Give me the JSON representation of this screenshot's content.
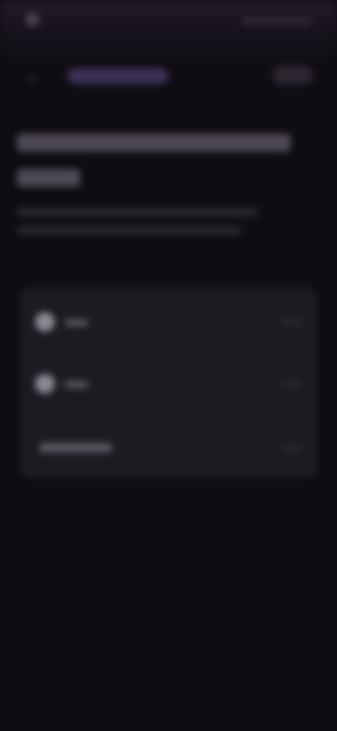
{
  "status_bar": {
    "time": "",
    "right": ""
  },
  "top_nav": {
    "center_label": "",
    "right_label": ""
  },
  "main": {
    "heading": "",
    "subtitle": ""
  },
  "card": {
    "rows": [
      {
        "label": "",
        "icon": "circle-icon"
      },
      {
        "label": "",
        "icon": "circle-icon"
      },
      {
        "label": ""
      }
    ]
  },
  "colors": {
    "background": "#100d12",
    "card": "#1d1a21",
    "accent": "#3a2f55"
  }
}
